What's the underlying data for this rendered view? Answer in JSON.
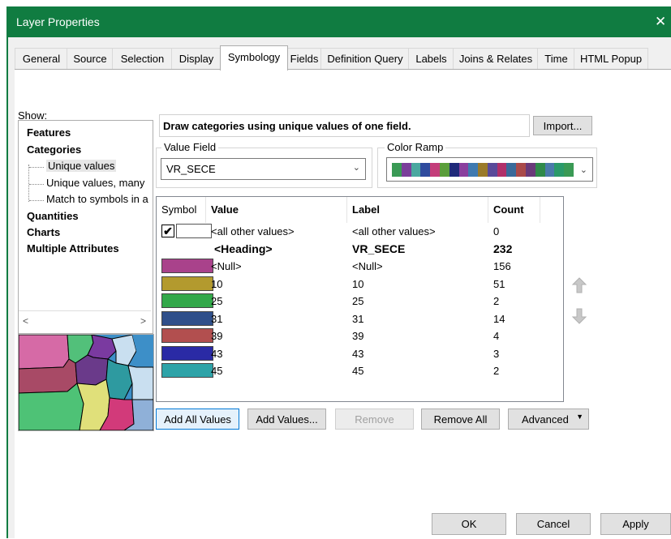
{
  "window": {
    "title": "Layer Properties",
    "close_glyph": "✕"
  },
  "tabs": [
    "General",
    "Source",
    "Selection",
    "Display",
    "Symbology",
    "Fields",
    "Definition Query",
    "Labels",
    "Joins & Relates",
    "Time",
    "HTML Popup"
  ],
  "active_tab": "Symbology",
  "show": {
    "label": "Show:",
    "items": [
      {
        "label": "Features",
        "bold": true
      },
      {
        "label": "Categories",
        "bold": true
      },
      {
        "label": "Unique values",
        "bold": false,
        "selected": true
      },
      {
        "label": "Unique values, many",
        "bold": false
      },
      {
        "label": "Match to symbols in a",
        "bold": false
      },
      {
        "label": "Quantities",
        "bold": true
      },
      {
        "label": "Charts",
        "bold": true
      },
      {
        "label": "Multiple Attributes",
        "bold": true
      }
    ],
    "scroll_left": "<",
    "scroll_right": ">"
  },
  "heading_text": "Draw categories using unique values of one field.",
  "import_label": "Import...",
  "value_field": {
    "label": "Value Field",
    "value": "VR_SECE"
  },
  "color_ramp": {
    "label": "Color Ramp",
    "colors": [
      "#3a9a55",
      "#7a3f9a",
      "#4aa8a0",
      "#2f4b9e",
      "#c43d7a",
      "#5a9e3a",
      "#1f2a7a",
      "#8a3f9e",
      "#3f7ab0",
      "#9a7a2a",
      "#5a4a9a",
      "#b0306a",
      "#3a6a9a",
      "#aa4a4a",
      "#6a3a7a",
      "#2f8a4a",
      "#4a7aaa",
      "#2a9a6a",
      "#3a9a55"
    ]
  },
  "table": {
    "headers": [
      "Symbol",
      "Value",
      "Label",
      "Count"
    ],
    "rows": [
      {
        "symbol": "check",
        "value": "<all other values>",
        "label": "<all other values>",
        "count": "0",
        "bold": false
      },
      {
        "symbol": "none",
        "value": "<Heading>",
        "label": "VR_SECE",
        "count": "232",
        "bold": true
      },
      {
        "symbol": "#a9428b",
        "value": "<Null>",
        "label": "<Null>",
        "count": "156",
        "bold": false
      },
      {
        "symbol": "#b39a2e",
        "value": "10",
        "label": "10",
        "count": "51",
        "bold": false
      },
      {
        "symbol": "#33a84a",
        "value": "25",
        "label": "25",
        "count": "2",
        "bold": false
      },
      {
        "symbol": "#2f4f8a",
        "value": "31",
        "label": "31",
        "count": "14",
        "bold": false
      },
      {
        "symbol": "#b24f4f",
        "value": "39",
        "label": "39",
        "count": "4",
        "bold": false
      },
      {
        "symbol": "#2a2aa5",
        "value": "43",
        "label": "43",
        "count": "3",
        "bold": false
      },
      {
        "symbol": "#2ea3a8",
        "value": "45",
        "label": "45",
        "count": "2",
        "bold": false
      }
    ]
  },
  "buttons": {
    "add_all": "Add All Values",
    "add_values": "Add Values...",
    "remove": "Remove",
    "remove_all": "Remove All",
    "advanced": "Advanced",
    "ok": "OK",
    "cancel": "Cancel",
    "apply": "Apply"
  },
  "arrows": {
    "up": "move-up-icon",
    "down": "move-down-icon"
  }
}
